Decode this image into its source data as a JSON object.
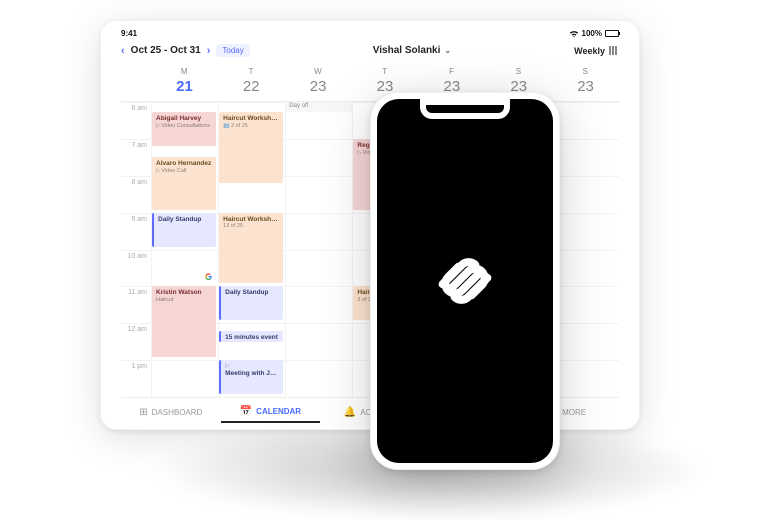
{
  "status": {
    "time": "9:41",
    "battery_pct": "100%",
    "wifi_icon": "wifi"
  },
  "toolbar": {
    "date_range": "Oct 25 - Oct 31",
    "today_label": "Today",
    "user_name": "Vishal Solanki",
    "view_label": "Weekly"
  },
  "week": {
    "days": [
      {
        "dow": "M",
        "num": "21",
        "today": true
      },
      {
        "dow": "T",
        "num": "22"
      },
      {
        "dow": "W",
        "num": "23"
      },
      {
        "dow": "T",
        "num": "23"
      },
      {
        "dow": "F",
        "num": "23"
      },
      {
        "dow": "S",
        "num": "23"
      },
      {
        "dow": "S",
        "num": "23"
      }
    ],
    "times": [
      "6 am",
      "7 am",
      "8 am",
      "9 am",
      "10 am",
      "11 am",
      "12 am",
      "1 pm"
    ],
    "allday": {
      "col": 2,
      "label": "Day off"
    }
  },
  "events": [
    {
      "col": 0,
      "row": 0,
      "span": 1,
      "cls": "ev-pink",
      "title": "Abigail Harvey",
      "sub": "Video Consultations",
      "icon": "video"
    },
    {
      "col": 1,
      "row": 0,
      "span": 2,
      "cls": "ev-peach",
      "title": "Haircut Workshops",
      "sub": "2 of 25",
      "icon": "users"
    },
    {
      "col": 0,
      "row": 1.5,
      "span": 1.5,
      "cls": "ev-peach",
      "title": "Alvaro Hernandez",
      "sub": "Video Call",
      "icon": "video"
    },
    {
      "col": 3,
      "row": 1,
      "span": 2,
      "cls": "ev-pink",
      "title": "Regin…",
      "sub": "Vide…",
      "icon": "video"
    },
    {
      "col": 0,
      "row": 3,
      "span": 1,
      "cls": "ev-blue",
      "title": "Daily Standup",
      "sub": ""
    },
    {
      "col": 1,
      "row": 3,
      "span": 2,
      "cls": "ev-peach",
      "title": "Haircut Workshops",
      "sub": "13 of 25"
    },
    {
      "col": 0,
      "row": 4,
      "span": 1,
      "cls": "",
      "title": "",
      "sub": "",
      "google": true
    },
    {
      "col": 0,
      "row": 5,
      "span": 2,
      "cls": "ev-pink",
      "title": "Kristin Watson",
      "sub": "Haircut"
    },
    {
      "col": 1,
      "row": 5,
      "span": 1,
      "cls": "ev-blue",
      "title": "Daily Standup",
      "sub": ""
    },
    {
      "col": 3,
      "row": 5,
      "span": 1,
      "cls": "ev-peach",
      "title": "Hairc…",
      "sub": "3 of 2…"
    },
    {
      "col": 1,
      "row": 6.2,
      "span": 0.4,
      "cls": "ev-blue",
      "title": "15 minutes event",
      "sub": ""
    },
    {
      "col": 1,
      "row": 7,
      "span": 1,
      "cls": "ev-blue",
      "title": "Meeting with Jo…",
      "sub": "",
      "icon": "video"
    }
  ],
  "tabs": {
    "dashboard": "DASHBOARD",
    "calendar": "CALENDAR",
    "activity": "ACTIVITY",
    "more": "MORE"
  },
  "phone": {
    "logo": "squarespace-logo"
  }
}
